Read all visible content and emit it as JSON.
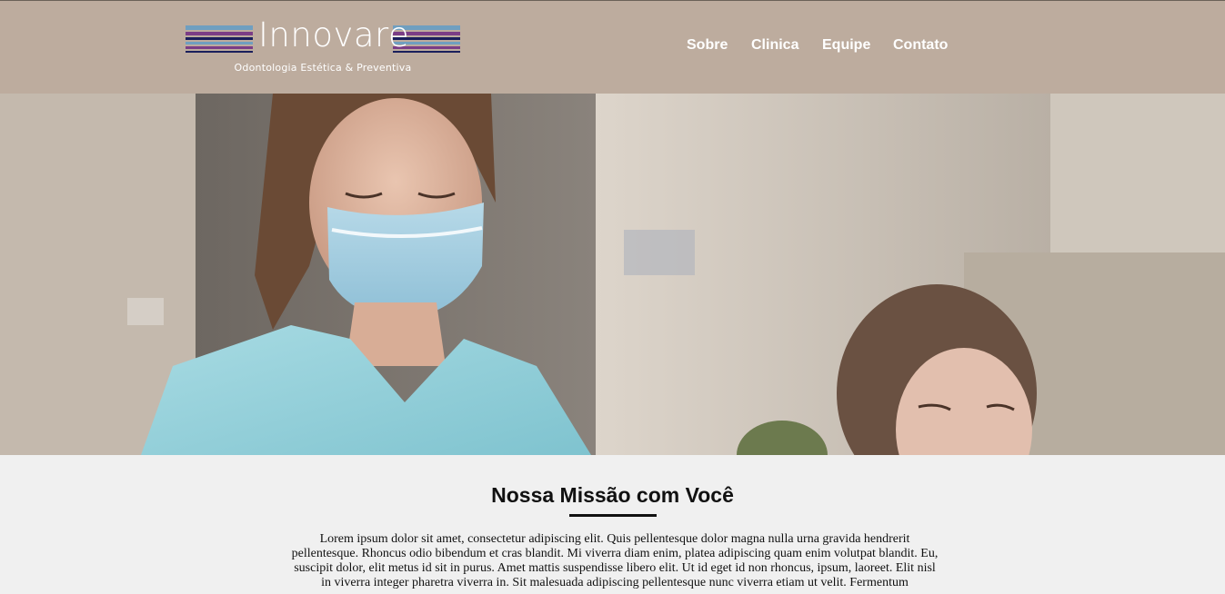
{
  "header": {
    "logo_word": "Innovare",
    "logo_tagline": "Odontologia Estética & Preventiva",
    "logo_stripe_colors": [
      "#6f9fc0",
      "#7b3d86",
      "#1a1f5c"
    ],
    "background": "#bdac9e"
  },
  "nav": {
    "items": [
      {
        "label": "Sobre"
      },
      {
        "label": "Clinica"
      },
      {
        "label": "Equipe"
      },
      {
        "label": "Contato"
      }
    ]
  },
  "hero": {
    "image": "dental-clinic-professionals-photo"
  },
  "mission": {
    "title": "Nossa Missão com Você",
    "body": "Lorem ipsum dolor sit amet, consectetur adipiscing elit. Quis pellentesque dolor magna nulla urna gravida hendrerit pellentesque. Rhoncus odio bibendum et cras blandit. Mi viverra diam enim, platea adipiscing quam enim volutpat blandit. Eu, suscipit dolor, elit metus id sit in purus. Amet mattis suspendisse libero elit. Ut id eget id non rhoncus, ipsum, laoreet. Elit nisl in viverra integer pharetra viverra in. Sit malesuada adipiscing pellentesque nunc viverra etiam ut velit. Fermentum"
  }
}
